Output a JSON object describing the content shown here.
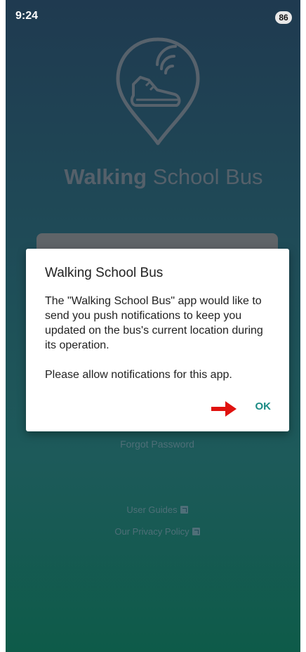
{
  "status_bar": {
    "time": "9:24",
    "battery": "86"
  },
  "app": {
    "title_bold": "Walking",
    "title_rest": " School Bus",
    "forgot_password": "Forgot Password",
    "user_guides": "User Guides",
    "privacy_policy": "Our Privacy Policy"
  },
  "dialog": {
    "title": "Walking School Bus",
    "message": "The \"Walking School Bus\" app would like to send you push notifications to keep you updated on the bus's current location during its operation.",
    "message2": "Please allow notifications for this app.",
    "ok_label": "OK"
  },
  "icons": {
    "logo": "map-pin-sneaker-wifi-icon",
    "external_link": "external-link-icon",
    "annotation_arrow": "red-arrow-right-icon"
  },
  "colors": {
    "accent": "#1a8a84",
    "arrow": "#e0120f",
    "background_top": "#1f3a50",
    "background_bottom": "#0e5b49"
  }
}
